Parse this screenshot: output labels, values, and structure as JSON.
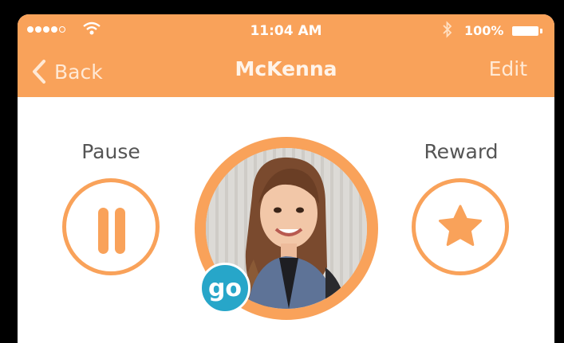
{
  "status_bar": {
    "time": "11:04 AM",
    "battery_percent": "100%",
    "signal_bars_filled": 4,
    "signal_bars_total": 5
  },
  "nav": {
    "back_label": "Back",
    "title": "McKenna",
    "edit_label": "Edit"
  },
  "actions": {
    "pause_label": "Pause",
    "reward_label": "Reward"
  },
  "badge": {
    "text": "go"
  },
  "colors": {
    "accent": "#F9A25A",
    "badge": "#27A6C9",
    "background": "#FFFFFF"
  },
  "icons": [
    "wifi-icon",
    "bluetooth-icon",
    "battery-icon",
    "chevron-left-icon",
    "pause-icon",
    "star-icon"
  ]
}
